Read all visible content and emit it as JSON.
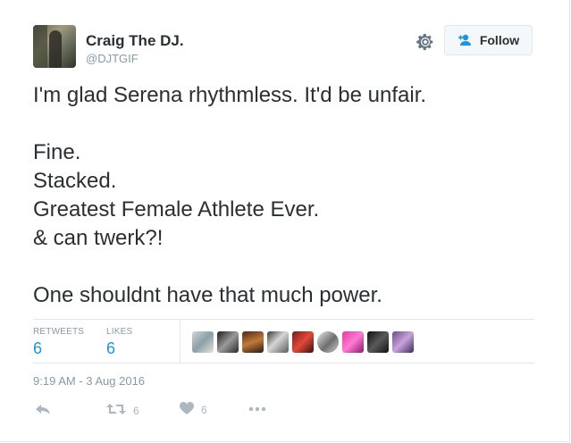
{
  "header": {
    "display_name": "Craig The DJ.",
    "handle": "@DJTGIF",
    "follow_label": "Follow",
    "settings_icon": "gear-icon",
    "follow_icon": "add-user-icon"
  },
  "tweet": {
    "lines": [
      "I'm glad Serena rhythmless. It'd be unfair.",
      "",
      "Fine.",
      "Stacked.",
      "Greatest Female Athlete Ever.",
      "& can twerk?!",
      "",
      "One shouldnt have that much power."
    ]
  },
  "stats": {
    "retweets_label": "RETWEETS",
    "retweets_value": "6",
    "likes_label": "LIKES",
    "likes_value": "6"
  },
  "timestamp": "9:19 AM - 3 Aug 2016",
  "actions": {
    "reply_icon": "reply-icon",
    "retweet_icon": "retweet-icon",
    "retweet_count": "6",
    "like_icon": "heart-icon",
    "like_count": "6",
    "more_icon": "more-icon"
  },
  "colors": {
    "link_blue": "#1b95e0",
    "muted": "#8899a6",
    "text": "#292f33",
    "border": "#e1e8ed"
  }
}
